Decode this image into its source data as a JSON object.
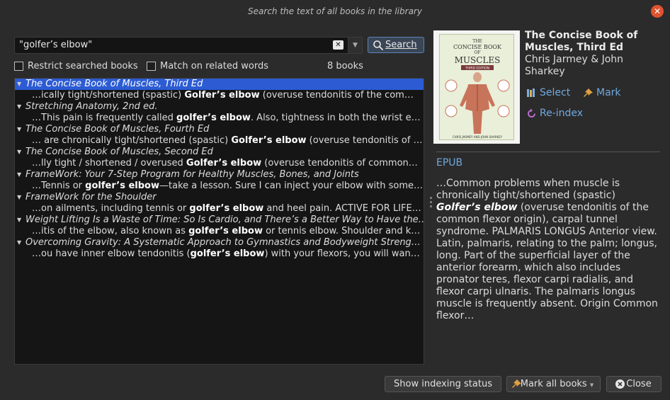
{
  "window": {
    "title": "Search the text of all books in the library"
  },
  "search": {
    "value": "\"golfer’s elbow\"",
    "button_label": "Search"
  },
  "options": {
    "restrict_label": "Restrict searched books",
    "match_related_label": "Match on related words",
    "book_count": "8 books"
  },
  "results": [
    {
      "title": "The Concise Book of Muscles, Third Ed",
      "selected": true,
      "snippet_pre": "…ically tight/shortened (spastic) ",
      "snippet_hit": "Golfer’s elbow",
      "snippet_post": " (overuse tendonitis of the com…"
    },
    {
      "title": "Stretching Anatomy, 2nd ed.",
      "snippet_pre": "…This pain is frequently called ",
      "snippet_hit": "golfer’s elbow",
      "snippet_post": ". Also, tightness in both the wrist e…"
    },
    {
      "title": "The Concise Book of Muscles, Fourth Ed",
      "snippet_pre": "… are chronically tight/shortened (spastic) ",
      "snippet_hit": "Golfer’s elbow",
      "snippet_post": " (overuse tendonitis of the com…"
    },
    {
      "title": "The Concise Book of Muscles, Second Ed",
      "snippet_pre": "…lly tight / shortened / overused ",
      "snippet_hit": "Golfer’s elbow",
      "snippet_post": " (overuse tendonitis of common…"
    },
    {
      "title": "FrameWork: Your 7-Step Program for Healthy Muscles, Bones, and Joints",
      "snippet_pre": "…Tennis or ",
      "snippet_hit": "golfer’s elbow",
      "snippet_post": "—take a lesson. Sure I can inject your elbow with some…"
    },
    {
      "title": "FrameWork for the Shoulder",
      "snippet_pre": "…on ailments, including tennis or ",
      "snippet_hit": "golfer’s elbow",
      "snippet_post": " and heel pain. ACTIVE FOR LIFE…"
    },
    {
      "title": "Weight Lifting Is a Waste of Time: So Is Cardio, and There’s a Better Way to Have the…",
      "snippet_pre": "…itis of the elbow, also known as ",
      "snippet_hit": "golfer’s elbow",
      "snippet_post": " or tennis elbow. Shoulder and k…"
    },
    {
      "title": "Overcoming Gravity: A Systematic Approach to Gymnastics and Bodyweight Streng…",
      "snippet_pre": "…ou have inner elbow tendonitis (",
      "snippet_hit": "golfer’s elbow",
      "snippet_post": ") with your flexors, you will wan…"
    }
  ],
  "details": {
    "title": "The Concise Book of Muscles, Third Ed",
    "authors": "Chris Jarmey & John Sharkey",
    "select_label": "Select",
    "mark_label": "Mark",
    "reindex_label": "Re-index",
    "format": "EPUB",
    "cover": {
      "line1": "THE",
      "line2": "CONCISE BOOK",
      "line3": "OF",
      "line4": "MUSCLES",
      "edition": "THIRD EDITION",
      "authors": "CHRIS JARMEY AND JOHN SHARKEY"
    },
    "preview_pre": "…Common problems when muscle is chronically tight/shortened (spastic) ",
    "preview_hit": "Golfer’s elbow",
    "preview_post": " (overuse tendonitis of the common flexor origin), carpal tunnel syndrome. PALMARIS LONGUS Anterior view. Latin, palmaris, relating to the palm; longus, long. Part of the superficial layer of the anterior forearm, which also includes pronator teres, flexor carpi radialis, and flexor carpi ulnaris. The palmaris longus muscle is frequently absent. Origin Common flexor…"
  },
  "footer": {
    "show_status_label": "Show indexing status",
    "mark_all_label": "Mark all books",
    "close_label": "Close"
  },
  "colors": {
    "accent": "#6fa9e0",
    "selection": "#2c5bd3",
    "close_red": "#e0522f"
  }
}
